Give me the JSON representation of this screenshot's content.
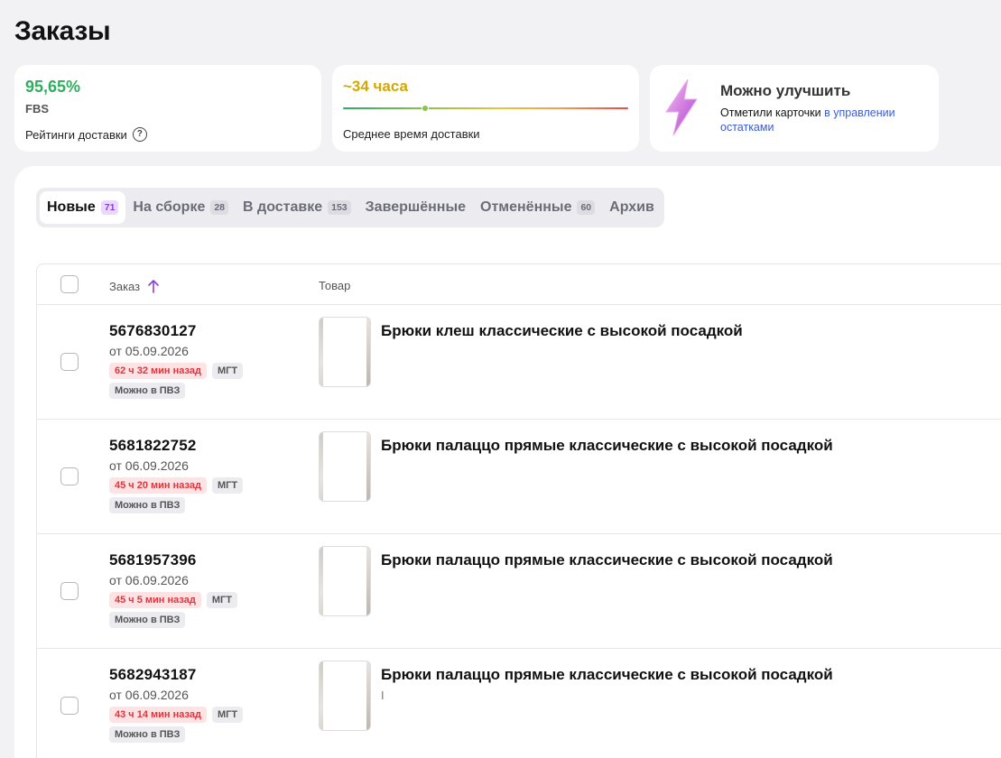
{
  "page": {
    "title": "Заказы"
  },
  "cards": {
    "rating": {
      "value": "95,65%",
      "sub": "FBS",
      "label": "Рейтинги доставки",
      "help": "?"
    },
    "delivery_time": {
      "value": "~34 часа",
      "label": "Среднее время доставки"
    },
    "improve": {
      "title": "Можно улучшить",
      "text": "Отметили карточки ",
      "link": "в управлении остатками",
      "icon": "lightning-icon"
    }
  },
  "tabs": [
    {
      "label": "Новые",
      "badge": "71",
      "active": true
    },
    {
      "label": "На сборке",
      "badge": "28"
    },
    {
      "label": "В доставке",
      "badge": "153"
    },
    {
      "label": "Завершённые",
      "badge": ""
    },
    {
      "label": "Отменённые",
      "badge": "60"
    },
    {
      "label": "Архив",
      "badge": ""
    }
  ],
  "table": {
    "columns": {
      "order": "Заказ",
      "product": "Товар"
    },
    "rows": [
      {
        "number": "5676830127",
        "date": "от 05.09.2026",
        "age": "62 ч 32 мин назад",
        "warehouse": "МГТ",
        "pickup": "Можно в ПВЗ",
        "product": "Брюки клеш классические с высокой посадкой",
        "sub": ""
      },
      {
        "number": "5681822752",
        "date": "от 06.09.2026",
        "age": "45 ч 20 мин назад",
        "warehouse": "МГТ",
        "pickup": "Можно в ПВЗ",
        "product": "Брюки палаццо прямые классические с высокой посадкой",
        "sub": ""
      },
      {
        "number": "5681957396",
        "date": "от 06.09.2026",
        "age": "45 ч 5 мин назад",
        "warehouse": "МГТ",
        "pickup": "Можно в ПВЗ",
        "product": "Брюки палаццо прямые классические с высокой посадкой",
        "sub": ""
      },
      {
        "number": "5682943187",
        "date": "от 06.09.2026",
        "age": "43 ч 14 мин назад",
        "warehouse": "МГТ",
        "pickup": "Можно в ПВЗ",
        "product": "Брюки палаццо прямые классические с высокой посадкой",
        "sub": "I"
      }
    ]
  },
  "colors": {
    "accent": "#8a3fd8",
    "success": "#2fae5c",
    "warning": "#d4a800",
    "danger": "#e0353d",
    "link": "#3a5bd9"
  }
}
